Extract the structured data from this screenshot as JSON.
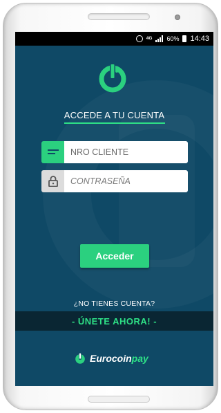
{
  "status_bar": {
    "network": "4G",
    "battery": "60%",
    "time": "14:43",
    "icons": [
      "alarm-icon",
      "signal-icon",
      "battery-icon"
    ]
  },
  "login": {
    "title": "ACCEDE A TU CUENTA",
    "client_placeholder": "NRO CLIENTE",
    "password_placeholder": "CONTRASEÑA",
    "submit_label": "Acceder",
    "client_icon": "id-card-icon",
    "password_icon": "lock-icon"
  },
  "signup": {
    "question": "¿NO TIENES CUENTA?",
    "link_label": "- ÚNETE AHORA! -"
  },
  "brand": {
    "name_main": "Eurocoin",
    "name_accent": "pay"
  },
  "colors": {
    "background": "#0f4966",
    "accent": "#2bd07f",
    "join_band": "#0a2633"
  }
}
